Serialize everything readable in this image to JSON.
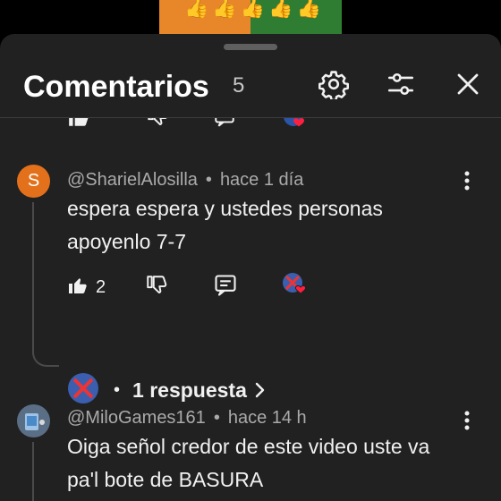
{
  "video": {
    "thumbnail_colors": [
      "#e8862a",
      "#2f7d32"
    ],
    "emoji": "👍👍👍👍👍"
  },
  "panel": {
    "title": "Comentarios",
    "count": "5",
    "icons": [
      "gear-icon",
      "sliders-icon",
      "close-icon"
    ]
  },
  "comments": [
    {
      "avatar_letter": "S",
      "avatar_color": "#e3711c",
      "author": "@SharielAlosilla",
      "separator": "•",
      "time": "hace 1 día",
      "text": "espera espera y ustedes personas apoyenlo 7-7",
      "likes": "2",
      "replies_label": "1 respuesta",
      "reply_separator": "•"
    },
    {
      "avatar_letter": "",
      "avatar_color": "#5a6f86",
      "author": "@MiloGames161",
      "separator": "•",
      "time": "hace 14 h",
      "text": "Oiga señol credor de este video uste va pa'l bote de BASURA"
    }
  ],
  "colors": {
    "background": "#212121",
    "text": "#f1f1f1",
    "secondary_text": "#aaaaaa",
    "heart": "#ff1f3d"
  }
}
